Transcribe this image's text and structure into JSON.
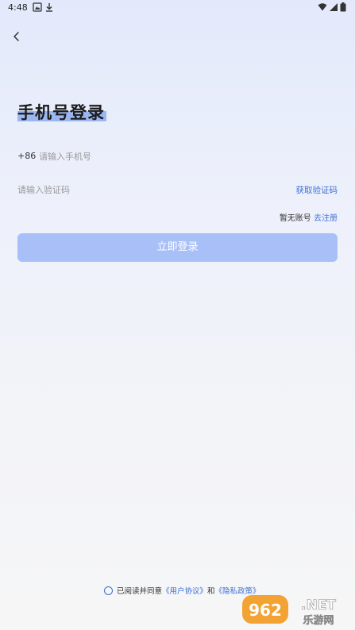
{
  "status_bar": {
    "time": "4:48"
  },
  "page": {
    "title": "手机号登录",
    "country_code": "+86",
    "phone_placeholder": "请输入手机号",
    "code_placeholder": "请输入验证码",
    "get_code_label": "获取验证码",
    "no_account_label": "暂无账号",
    "register_label": "去注册",
    "login_button_label": "立即登录"
  },
  "agreement": {
    "prefix": "已阅读并同意",
    "user_agreement": "《用户协议》",
    "conjunction": "和",
    "privacy_policy": "《隐私政策》"
  },
  "watermark": {
    "brand": "962.NET",
    "sub": "乐游网"
  },
  "colors": {
    "accent": "#3d6fd6",
    "button_disabled": "#a8c0f7",
    "title_highlight": "#9cb6f2"
  }
}
